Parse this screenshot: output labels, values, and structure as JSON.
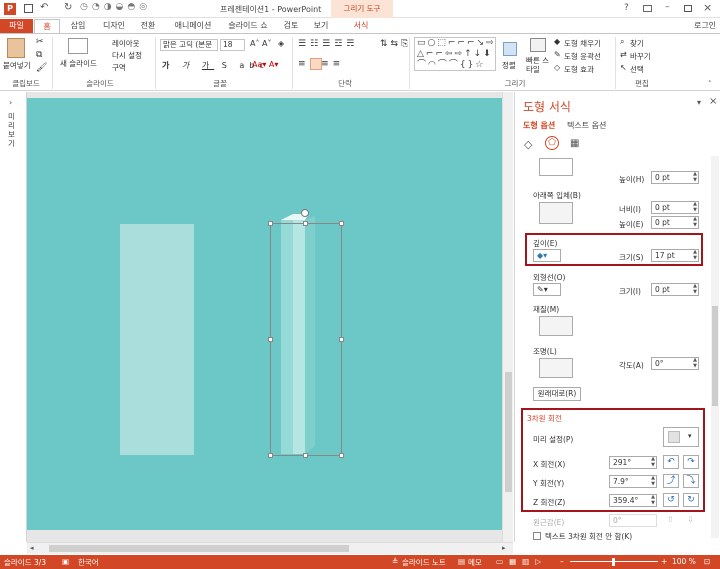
{
  "title_bar": {
    "title": "프레젠테이션1 - PowerPoint",
    "context_tab_group": "그리기 도구",
    "window_controls": [
      "?",
      "□",
      "–",
      "□",
      "×"
    ]
  },
  "tabs": [
    "파일",
    "홈",
    "삽입",
    "디자인",
    "전환",
    "애니메이션",
    "슬라이드 쇼",
    "검토",
    "보기",
    "서식"
  ],
  "active_tab": "홈",
  "account": "로그인",
  "ribbon": {
    "clipboard": {
      "paste": "붙여넣기",
      "label": "클립보드"
    },
    "slides": {
      "new_slide": "새 슬라이드",
      "layout": "레이아웃",
      "reset": "다시 설정",
      "section": "구역",
      "label": "슬라이드"
    },
    "font": {
      "font_name": "맑은 고딕 (본문",
      "font_size": "18",
      "label": "글꼴"
    },
    "paragraph": {
      "label": "단락"
    },
    "drawing": {
      "arrange": "정렬",
      "quick_styles": "빠른 스타일",
      "shape_fill": "도형 채우기",
      "shape_outline": "도형 윤곽선",
      "shape_effects": "도형 효과",
      "label": "그리기"
    },
    "editing": {
      "find": "찾기",
      "replace": "바꾸기",
      "select": "선택",
      "label": "편집"
    }
  },
  "left_pane_label": "미리 보기",
  "format_pane": {
    "title": "도형 서식",
    "tab_shape": "도형 옵션",
    "tab_text": "텍스트 옵션",
    "rows": {
      "top_height_label": "높이(H)",
      "top_height_value": "0 pt",
      "bottom_bevel_label": "아래쪽 입체(B)",
      "bottom_width_label": "너비(I)",
      "bottom_width_value": "0 pt",
      "bottom_height_label": "높이(E)",
      "bottom_height_value": "0 pt",
      "depth_label": "깊이(E)",
      "depth_size_label": "크기(S)",
      "depth_size_value": "17 pt",
      "contour_label": "외형선(O)",
      "contour_size_label": "크기(I)",
      "contour_size_value": "0 pt",
      "material_label": "재질(M)",
      "lighting_label": "조명(L)",
      "angle_label": "각도(A)",
      "angle_value": "0°",
      "reset_button": "원래대로(R)"
    },
    "rotation": {
      "section_title": "3차원 회전",
      "preset_label": "미리 설정(P)",
      "x_label": "X 회전(X)",
      "x_value": "291°",
      "y_label": "Y 회전(Y)",
      "y_value": "7.9°",
      "z_label": "Z 회전(Z)",
      "z_value": "359.4°",
      "perspective_label": "원근감(E)",
      "perspective_value": "0°",
      "keep_text_flat": "텍스트 3차원 회전 안 함(K)"
    }
  },
  "status_bar": {
    "slide": "슬라이드 3/3",
    "language": "한국어",
    "notes": "슬라이드 노트",
    "comments": "메모",
    "zoom": "100 %"
  },
  "colors": {
    "accent": "#d24726",
    "canvas": "#6cc8c7",
    "highlight": "#a3141b"
  }
}
